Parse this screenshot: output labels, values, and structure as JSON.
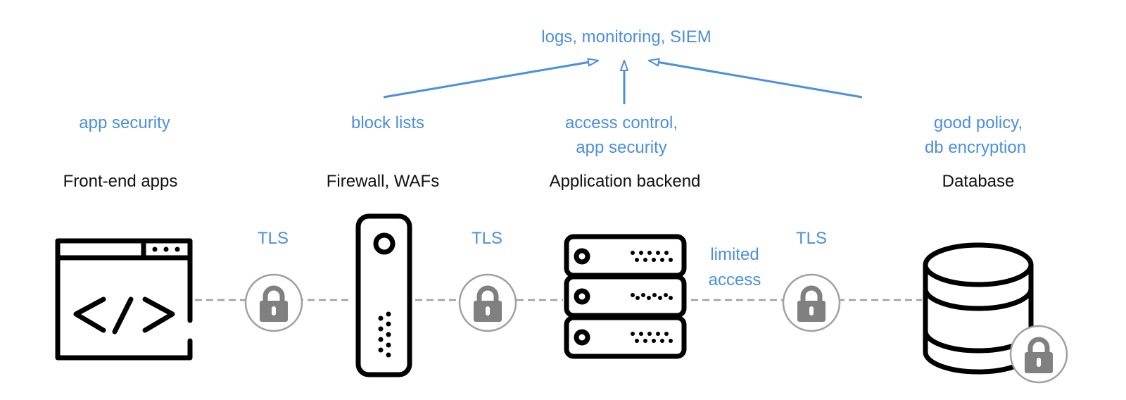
{
  "top": {
    "label": "logs, monitoring, SIEM"
  },
  "annotations": {
    "frontend": "app security",
    "firewall": "block lists",
    "backend_line1": "access control,",
    "backend_line2": "app security",
    "database_line1": "good policy,",
    "database_line2": "db encryption"
  },
  "components": {
    "frontend": "Front-end apps",
    "firewall": "Firewall, WAFs",
    "backend": "Application backend",
    "database": "Database"
  },
  "links": {
    "tls1": "TLS",
    "tls2": "TLS",
    "tls3": "TLS",
    "limited_line1": "limited",
    "limited_line2": "access"
  },
  "colors": {
    "accent": "#4a8fe0",
    "lock": "#808080",
    "line": "#a0a0a0"
  }
}
